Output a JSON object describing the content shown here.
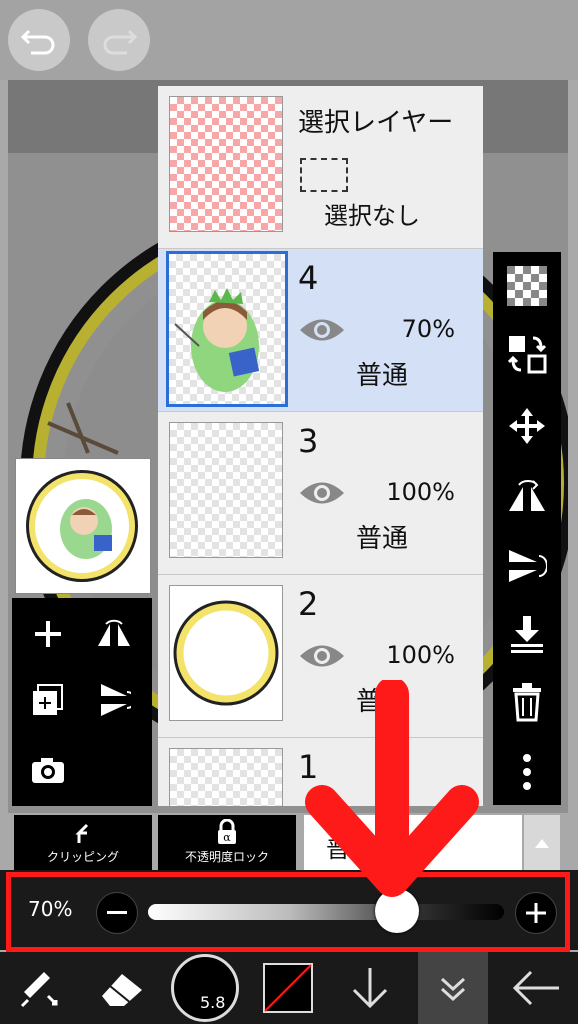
{
  "layers": {
    "selection": {
      "title": "選択レイヤー",
      "status": "選択なし"
    },
    "items": [
      {
        "number": "4",
        "opacity": "70%",
        "mode": "普通"
      },
      {
        "number": "3",
        "opacity": "100%",
        "mode": "普通"
      },
      {
        "number": "2",
        "opacity": "100%",
        "mode": "普通"
      },
      {
        "number": "1"
      }
    ]
  },
  "blend": {
    "clipping_label": "クリッピング",
    "lock_label": "不透明度ロック",
    "mode_value": "普"
  },
  "opacity_slider": {
    "value_label": "70%",
    "value": 0.7
  },
  "toolbar": {
    "brush_size": "5.8"
  },
  "colors": {
    "accent_red": "#ff1a1a",
    "selected_border": "#2b6fd6",
    "selected_row": "#d3e0f5"
  }
}
